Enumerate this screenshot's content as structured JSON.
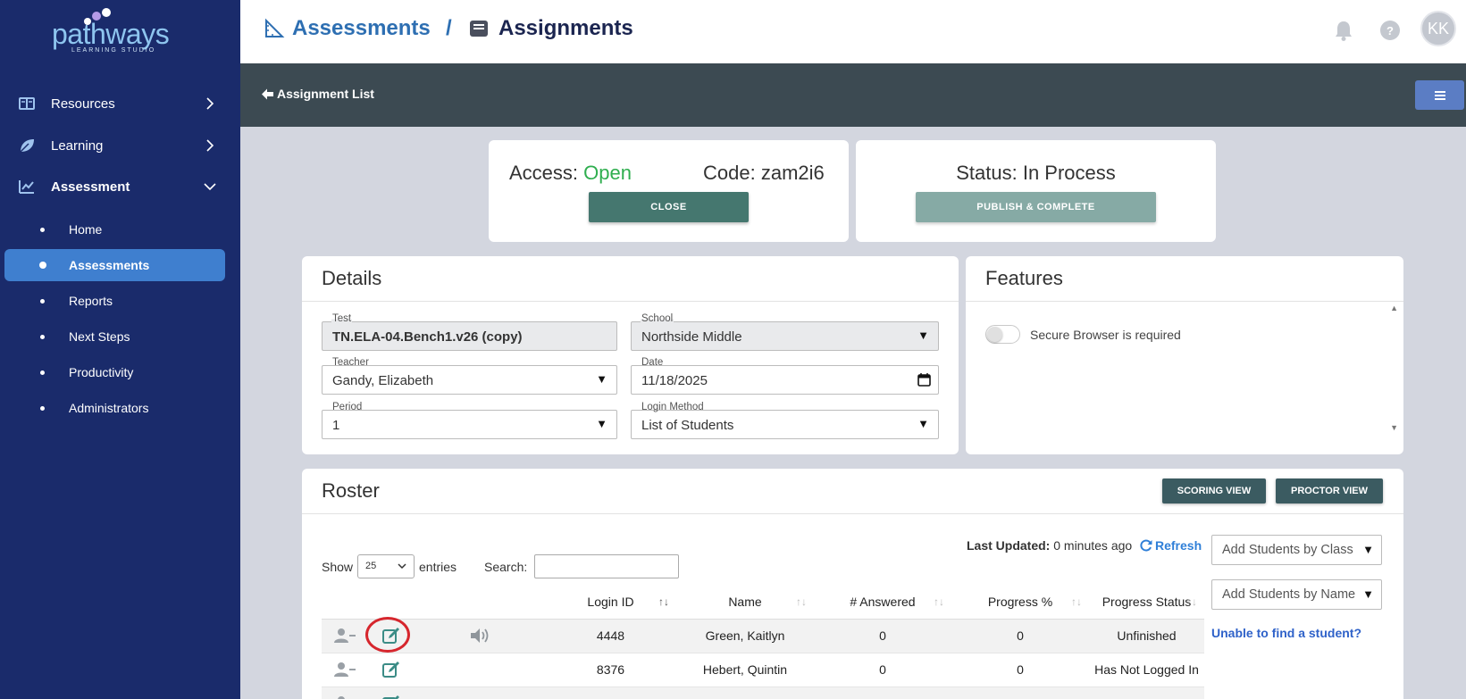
{
  "brand": {
    "name": "pathways",
    "subtitle": "LEARNING STUDIO"
  },
  "sidebar": {
    "items": [
      {
        "label": "Resources",
        "icon": "book-icon"
      },
      {
        "label": "Learning",
        "icon": "leaf-icon"
      },
      {
        "label": "Assessment",
        "icon": "chart-line-icon"
      }
    ],
    "assessment_subitems": [
      {
        "label": "Home"
      },
      {
        "label": "Assessments",
        "active": true
      },
      {
        "label": "Reports"
      },
      {
        "label": "Next Steps"
      },
      {
        "label": "Productivity"
      },
      {
        "label": "Administrators"
      }
    ]
  },
  "header": {
    "breadcrumb": [
      "Assessments",
      "Assignments"
    ],
    "separator": "/",
    "avatar_initials": "KK"
  },
  "toolbar": {
    "back_label": "Assignment List"
  },
  "access": {
    "access_label": "Access:",
    "access_value": "Open",
    "code_label": "Code:",
    "code_value": "zam2i6",
    "close_button": "CLOSE"
  },
  "status": {
    "label": "Status:",
    "value": "In Process",
    "publish_button": "PUBLISH & COMPLETE"
  },
  "details": {
    "title": "Details",
    "test": {
      "label": "Test",
      "value": "TN.ELA-04.Bench1.v26 (copy)"
    },
    "school": {
      "label": "School",
      "value": "Northside Middle"
    },
    "teacher": {
      "label": "Teacher",
      "value": "Gandy, Elizabeth"
    },
    "date": {
      "label": "Date",
      "value": "11/18/2025"
    },
    "period": {
      "label": "Period",
      "value": "1"
    },
    "login_method": {
      "label": "Login Method",
      "value": "List of Students"
    }
  },
  "features": {
    "title": "Features",
    "secure_browser_label": "Secure Browser is required",
    "secure_browser_enabled": false
  },
  "roster": {
    "title": "Roster",
    "scoring_view_button": "SCORING VIEW",
    "proctor_view_button": "PROCTOR VIEW",
    "show_label": "Show",
    "entries_label": "entries",
    "entries_value": "25",
    "search_label": "Search:",
    "search_value": "",
    "last_updated_label": "Last Updated:",
    "last_updated_value": "0 minutes ago",
    "refresh_label": "Refresh",
    "add_by_class": "Add Students by Class",
    "add_by_name": "Add Students by Name",
    "unable_link": "Unable to find a student?",
    "columns": [
      "Login ID",
      "Name",
      "# Answered",
      "Progress %",
      "Progress Status"
    ],
    "rows": [
      {
        "login_id": "4448",
        "name": "Green, Kaitlyn",
        "answered": "0",
        "progress": "0",
        "status": "Unfinished"
      },
      {
        "login_id": "8376",
        "name": "Hebert, Quintin",
        "answered": "0",
        "progress": "0",
        "status": "Has Not Logged In"
      },
      {
        "login_id": "",
        "name": "",
        "answered": "",
        "progress": "",
        "status": ""
      }
    ]
  },
  "colors": {
    "sidebar_bg": "#1a2b6b",
    "active_item": "#3f7fcf",
    "open_green": "#2fae4f",
    "toolbar_bg": "#3c4a52",
    "teal_button": "#45776f"
  }
}
